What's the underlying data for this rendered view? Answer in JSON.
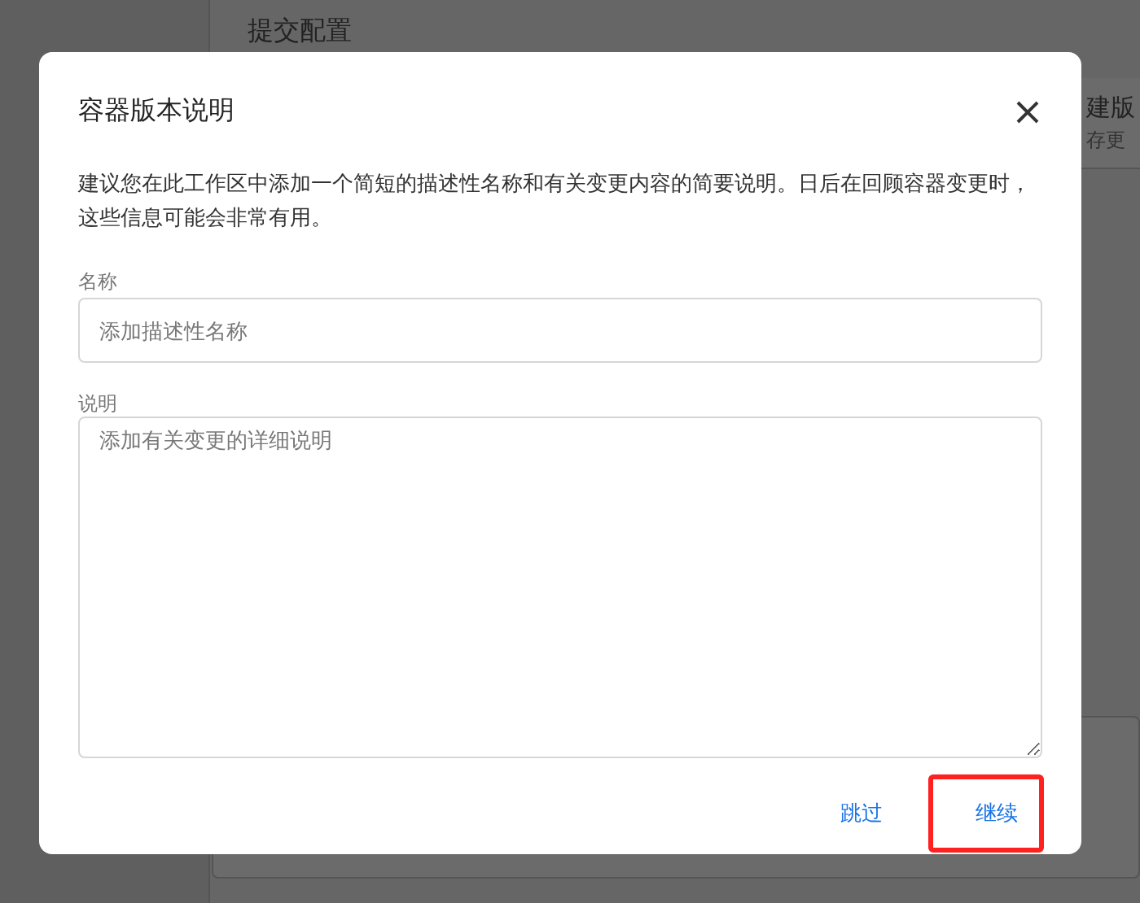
{
  "page": {
    "title": "提交配置",
    "side_card": {
      "line_1": "建版",
      "line_2": "存更"
    }
  },
  "dialog": {
    "title": "容器版本说明",
    "description": "建议您在此工作区中添加一个简短的描述性名称和有关变更内容的简要说明。日后在回顾容器变更时，这些信息可能会非常有用。",
    "fields": [
      {
        "kind": "input",
        "label": "名称",
        "placeholder": "添加描述性名称"
      },
      {
        "kind": "textarea",
        "label": "说明",
        "placeholder": "添加有关变更的详细说明"
      }
    ],
    "buttons": [
      {
        "label": "跳过",
        "highlighted": false
      },
      {
        "label": "继续",
        "highlighted": true
      }
    ]
  }
}
